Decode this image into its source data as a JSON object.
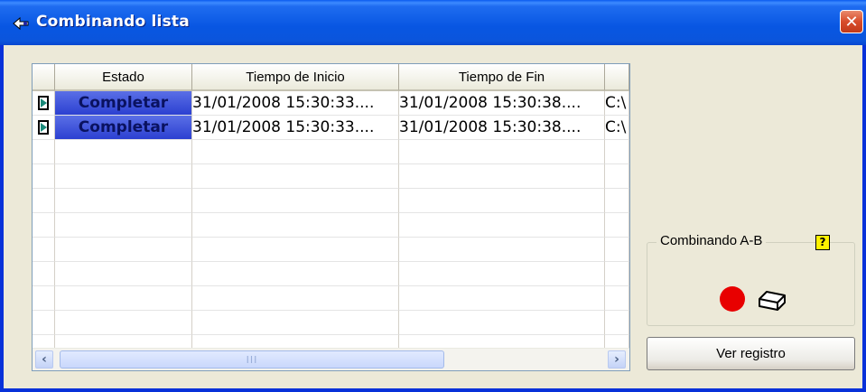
{
  "window": {
    "title": "Combinando lista",
    "close_glyph": "✕"
  },
  "table": {
    "columns": [
      "Estado",
      "Tiempo de Inicio",
      "Tiempo de Fin"
    ],
    "rows": [
      {
        "estado": "Completar",
        "inicio": "31/01/2008 15:30:33....",
        "fin": "31/01/2008 15:30:38....",
        "extra": "C:\\"
      },
      {
        "estado": "Completar",
        "inicio": "31/01/2008 15:30:33....",
        "fin": "31/01/2008 15:30:38....",
        "extra": "C:\\"
      }
    ],
    "scroll_left": "‹",
    "scroll_right": "›",
    "thumb_grip": "III"
  },
  "group": {
    "label": "Combinando A-B",
    "help": "?"
  },
  "buttons": {
    "log": "Ver registro"
  },
  "colors": {
    "selected_state": "#3B4FD8",
    "record": "#E80000"
  }
}
